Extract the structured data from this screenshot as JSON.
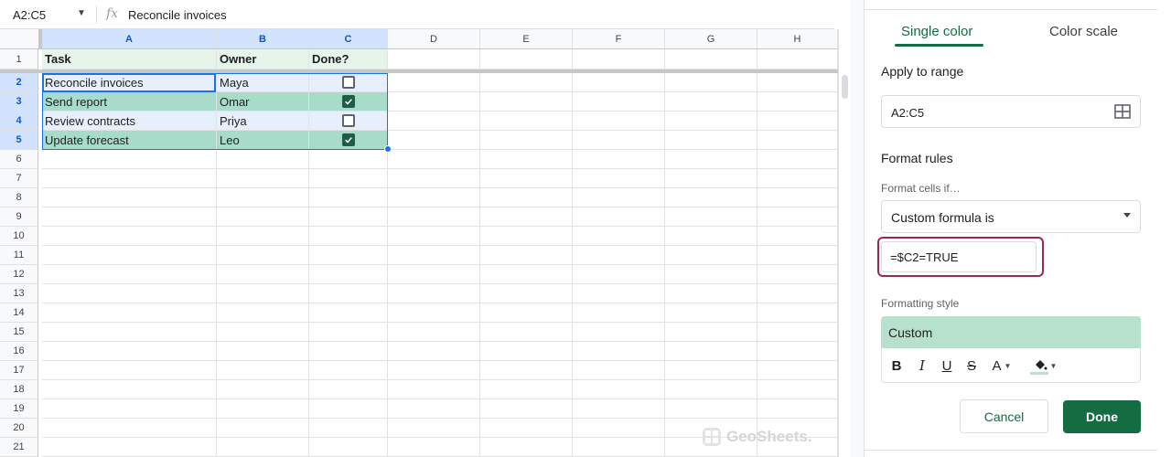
{
  "formula_bar": {
    "name_box": "A2:C5",
    "fx_symbol": "fx",
    "formula": "Reconcile invoices"
  },
  "sheet": {
    "columns": [
      "A",
      "B",
      "C",
      "D",
      "E",
      "F",
      "G",
      "H"
    ],
    "selected_columns": [
      "A",
      "B",
      "C"
    ],
    "row_numbers": [
      "1",
      "2",
      "3",
      "4",
      "5",
      "6",
      "7",
      "8",
      "9",
      "10",
      "11",
      "12",
      "13",
      "14",
      "15",
      "16",
      "17",
      "18",
      "19",
      "20",
      "21"
    ],
    "selected_rows": [
      "2",
      "3",
      "4",
      "5"
    ],
    "headers": [
      "Task",
      "Owner",
      "Done?"
    ],
    "rows": [
      {
        "task": "Reconcile invoices",
        "owner": "Maya",
        "done": false,
        "highlighted": false
      },
      {
        "task": "Send report",
        "owner": "Omar",
        "done": true,
        "highlighted": true
      },
      {
        "task": "Review contracts",
        "owner": "Priya",
        "done": false,
        "highlighted": false
      },
      {
        "task": "Update forecast",
        "owner": "Leo",
        "done": true,
        "highlighted": true
      }
    ]
  },
  "watermark": "GeoSheets.",
  "panel": {
    "tabs": [
      "Single color",
      "Color scale"
    ],
    "active_tab": "Single color",
    "apply_to_range_label": "Apply to range",
    "range_value": "A2:C5",
    "format_rules_label": "Format rules",
    "format_cells_if_label": "Format cells if…",
    "condition_value": "Custom formula is",
    "custom_formula": "=$C2=TRUE",
    "formatting_style_label": "Formatting style",
    "style_preview": "Custom",
    "toolbar": {
      "bold": "B",
      "italic": "I",
      "underline": "U",
      "strikethrough": "S",
      "text_color": "A"
    },
    "cancel_label": "Cancel",
    "done_label": "Done"
  },
  "colors": {
    "accent_green": "#146c43",
    "highlight_fill": "#b7e1cd",
    "selection_blue": "#1a73e8",
    "formula_highlight": "#9c2a4a"
  }
}
